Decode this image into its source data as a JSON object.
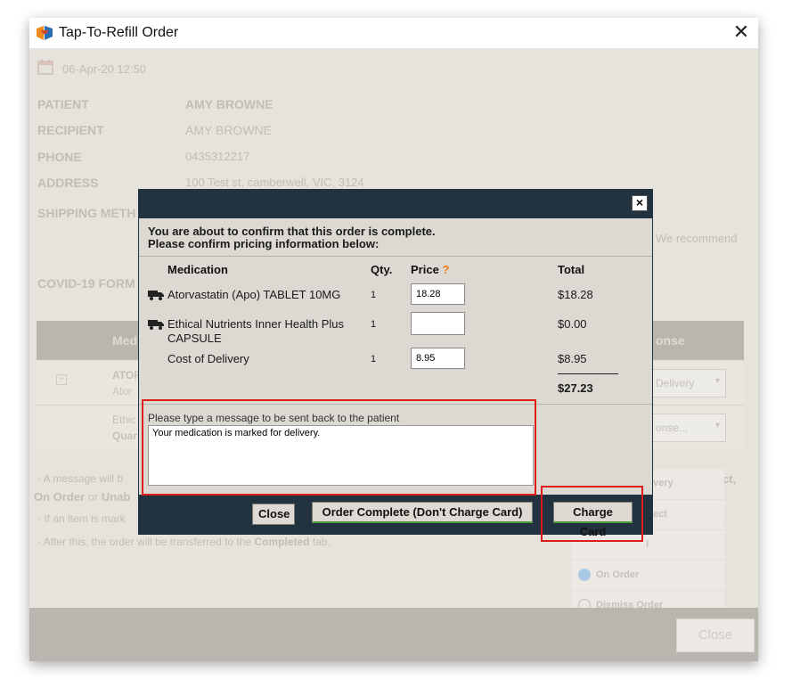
{
  "window": {
    "title": "Tap-To-Refill Order",
    "close_glyph": "✕"
  },
  "background": {
    "date": "06-Apr-20 12:50",
    "fields": [
      {
        "label": "PATIENT",
        "value": "AMY BROWNE"
      },
      {
        "label": "RECIPIENT",
        "value": "AMY BROWNE"
      },
      {
        "label": "PHONE",
        "value": "0435312217"
      },
      {
        "label": "ADDRESS",
        "value": "100 Test st, camberwell, VIC, 3124"
      }
    ],
    "shipping_label": "SHIPPING METH",
    "we_recommend": "We recommend",
    "covid_label": "COVID-19 FORM",
    "table_head_left": "Med",
    "table_head_right": "onse",
    "row1_name": "ATOR",
    "row1_sub": "Ator",
    "row1_select": "Delivery",
    "row2_name": "Ethic",
    "row2_sub": "Quar",
    "row2_select": "onse...",
    "note1": "· A message will b",
    "note1_tail": "ct,",
    "note1b_a": "On Order",
    "note1b_b": "or",
    "note1b_c": "Unab",
    "note2": "· If an item is mark",
    "note2_tail": "t",
    "note3_prefix": "· After this, the order will be transferred to the",
    "note3_bold": "Completed",
    "note3_suffix": "tab.",
    "menu": [
      "livery",
      "llect",
      "l",
      "On Order",
      "Dismiss Order"
    ],
    "close_label": "Close"
  },
  "dialog": {
    "close_glyph": "×",
    "intro_line1": "You are about to confirm that this order is complete.",
    "intro_line2": "Please confirm pricing information below:",
    "headers": {
      "medication": "Medication",
      "qty": "Qty.",
      "price": "Price",
      "price_hint": "?",
      "total": "Total"
    },
    "rows": [
      {
        "name": "Atorvastatin (Apo) TABLET 10MG",
        "qty": "1",
        "price": "18.28",
        "total": "$18.28"
      },
      {
        "name_line1": "Ethical Nutrients Inner Health Plus",
        "name_line2": "CAPSULE",
        "qty": "1",
        "price": "",
        "total": "$0.00"
      },
      {
        "name": "Cost of Delivery",
        "qty": "1",
        "price": "8.95",
        "total": "$8.95"
      }
    ],
    "grand_total": "$27.23",
    "message_label": "Please type a message to be sent back to the patient",
    "message_value": "Your medication is marked for delivery.",
    "buttons": {
      "close": "Close",
      "order_complete": "Order Complete (Don't Charge Card)",
      "charge_card": "Charge Card"
    }
  },
  "colors": {
    "dialog_header": "#23323f",
    "highlight": "#e01b1b",
    "accent_orange": "#f07a1a"
  }
}
